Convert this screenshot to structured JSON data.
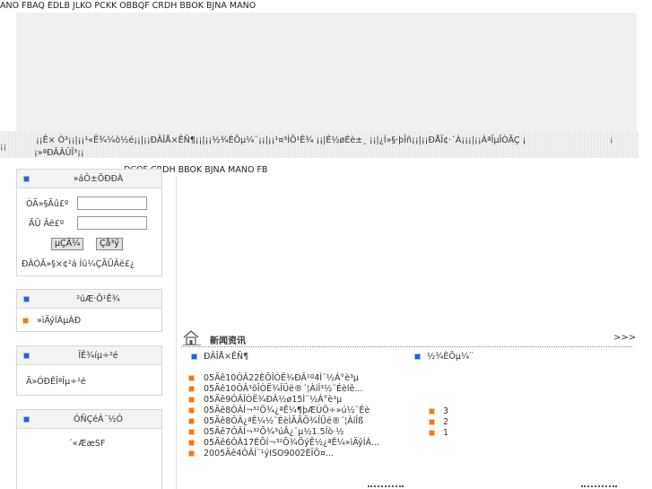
{
  "header": {
    "top_text": "ANO FBAQ EDLB JLKO PCKK OBBQF CRDH BBOK BJNA MANO"
  },
  "nav": {
    "line1": "¡¡Ê× Ò³¡¡|¡¡¹«Ë¾¼ò½é¡¡|¡¡ÐÂÎÅ×ÊÑ¶¡¡|¡¡½¾ÈÕµ¼¨¡¡|¡¡¹¤³ÌÕ¹Ê¾ ¡¡|Ê½øÉè±¸ ¡¡|¿Í»§·þÎñ¡¡|¡¡ÐÅÏ¢·´À¡¡¡|¡¡ÁªÏµÎÒÃÇ ¡",
    "line2": "¡»ªÐÂÂÛÎ³¡¡",
    "side_left": "¡¡",
    "side_right": "¡"
  },
  "main_heading": "DCQF CRDH BBOK BJNA MANO FB",
  "login_box": {
    "title": "»áÔ±ÕÐÐÀ",
    "username_label": "ÓÃ»§Ãû£º",
    "username_value": "",
    "password_label": "ÃÜ  Âë£º",
    "password_value": "",
    "login_button": "µÇÂ¼",
    "register_button": "Çå³ý",
    "links": "ÐÂÓÃ»§×¢²á  Íü¼ÇÃÜÂë£¿"
  },
  "product_box": {
    "title": "²úÆ·Õ¹Ê¾",
    "item": "»ìÄýÍÁµÀÐ"
  },
  "engineering_box": {
    "title": "ÎÊ¾íµ÷²é",
    "item": "Ã»ÓÐÊÎªÎµ÷²é"
  },
  "contact_box": {
    "title": "ÓÑÇéÁ´½Ó",
    "item": "´«ÆæSF"
  },
  "news": {
    "title": "新闻资讯",
    "more": ">>>",
    "subtitle_left": "ÐÂÎÅ×ÊÑ¶",
    "subtitle_right": "½¾ÈÕµ¼¨",
    "items": [
      "05Äê10ÔÂ22ÈÕÎÒË¾ÐÂ¹º4Ì¨½Á°è³µ",
      "05Äê10ÔÂ³õÎÒË¾ÎÜë®´¦ÀíÍ³½¨Éèlê...",
      "05Äê9ÔÂÎÒË¾ÐÂ½ø15Ì¨½Á°è³µ",
      "05Äê8ÔÂÍ¬³²Õ¾¿ªÊ¼¶þÆÚÖ÷»ú½¨Éè",
      "05Äê8ÔÂ¿ªÊ¼½¨ÉèÌÃÃÕ¾ÎÜë®´¦ÀíÎß",
      "05Äê7ÔÂÍ¬³²Õ¾³úÂ¿¨µ½1.5Íò·½",
      "05Äê6ÔÂ17ÈÕÍ¬³²Õ¾ÕýÊ½¿ªÊ¼»ìÄýÍÁ...",
      "2005Äê4ÔÂÍ¨¹ýISO9002ÈÏÖ¤..."
    ],
    "ranks": [
      "3",
      "2",
      "1"
    ]
  },
  "colors": {
    "blue_icon": "#2266cc",
    "orange_icon": "#ee7722",
    "banner_bg": "#f0f0f0"
  }
}
